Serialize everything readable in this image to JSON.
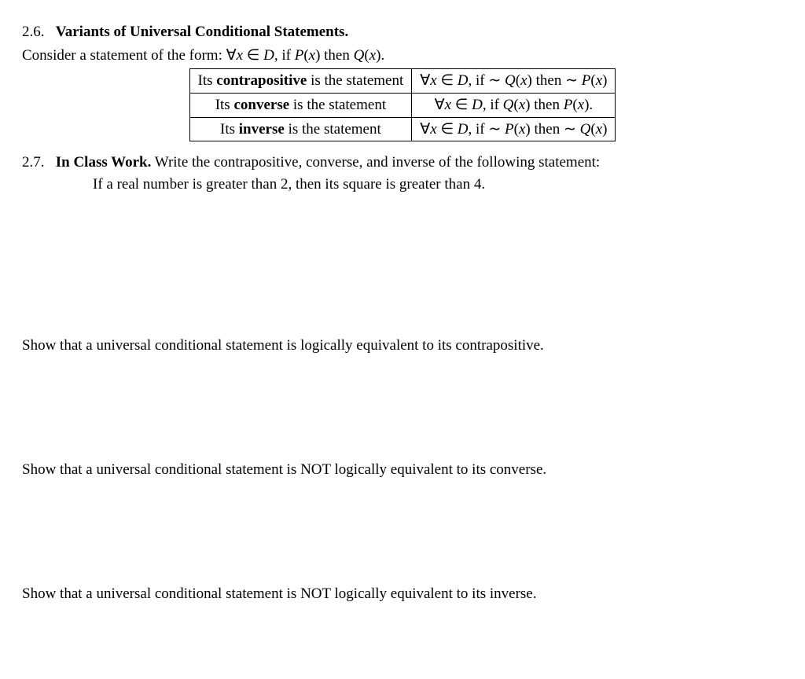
{
  "s26": {
    "num": "2.6.",
    "title": "Variants of Universal Conditional Statements.",
    "consider_a": "Consider a statement of the form: ",
    "consider_b_forall": "∀",
    "consider_b_x": "x",
    "consider_b_in": " ∈ ",
    "consider_b_D": "D",
    "consider_b_mid": ",  if ",
    "consider_b_P": "P",
    "consider_b_lp": "(",
    "consider_b_x2": "x",
    "consider_b_rp": ")",
    "consider_b_then": " then ",
    "consider_b_Q": "Q",
    "consider_b_lp2": "(",
    "consider_b_x3": "x",
    "consider_b_rp2": ").",
    "rows": {
      "contrapositive": {
        "left_a": "Its ",
        "left_b": "contrapositive",
        "left_c": " is the statement",
        "r_forall": "∀",
        "r_x": "x",
        "r_in": " ∈ ",
        "r_D": "D",
        "r_if": ",  if  ∼ ",
        "r_Q": "Q",
        "r_lp": "(",
        "r_x2": "x",
        "r_rp": ")",
        "r_then": " then  ∼ ",
        "r_P": "P",
        "r_lp2": "(",
        "r_x3": "x",
        "r_rp2": ")"
      },
      "converse": {
        "left_a": "Its ",
        "left_b": "converse",
        "left_c": " is the statement",
        "r_forall": "∀",
        "r_x": "x",
        "r_in": " ∈ ",
        "r_D": "D",
        "r_if": ",  if ",
        "r_Q": "Q",
        "r_lp": "(",
        "r_x2": "x",
        "r_rp": ")",
        "r_then": " then ",
        "r_P": "P",
        "r_lp2": "(",
        "r_x3": "x",
        "r_rp2": ")."
      },
      "inverse": {
        "left_a": "Its ",
        "left_b": "inverse",
        "left_c": " is the statement",
        "r_forall": "∀",
        "r_x": "x",
        "r_in": " ∈ ",
        "r_D": "D",
        "r_if": ",  if  ∼ ",
        "r_P": "P",
        "r_lp": "(",
        "r_x2": "x",
        "r_rp": ")",
        "r_then": " then  ∼ ",
        "r_Q": "Q",
        "r_lp2": "(",
        "r_x3": "x",
        "r_rp2": ")"
      }
    }
  },
  "s27": {
    "num": "2.7.",
    "title": "In Class Work.",
    "prompt": " Write the contrapositive, converse, and inverse of the following statement:",
    "statement": "If a real number is greater than 2, then its square is greater than 4.",
    "task1": "Show that a universal conditional statement is logically equivalent to its contrapositive.",
    "task2": "Show that a universal conditional statement is NOT logically equivalent to its converse.",
    "task3": "Show that a universal conditional statement is NOT logically equivalent to its inverse."
  }
}
